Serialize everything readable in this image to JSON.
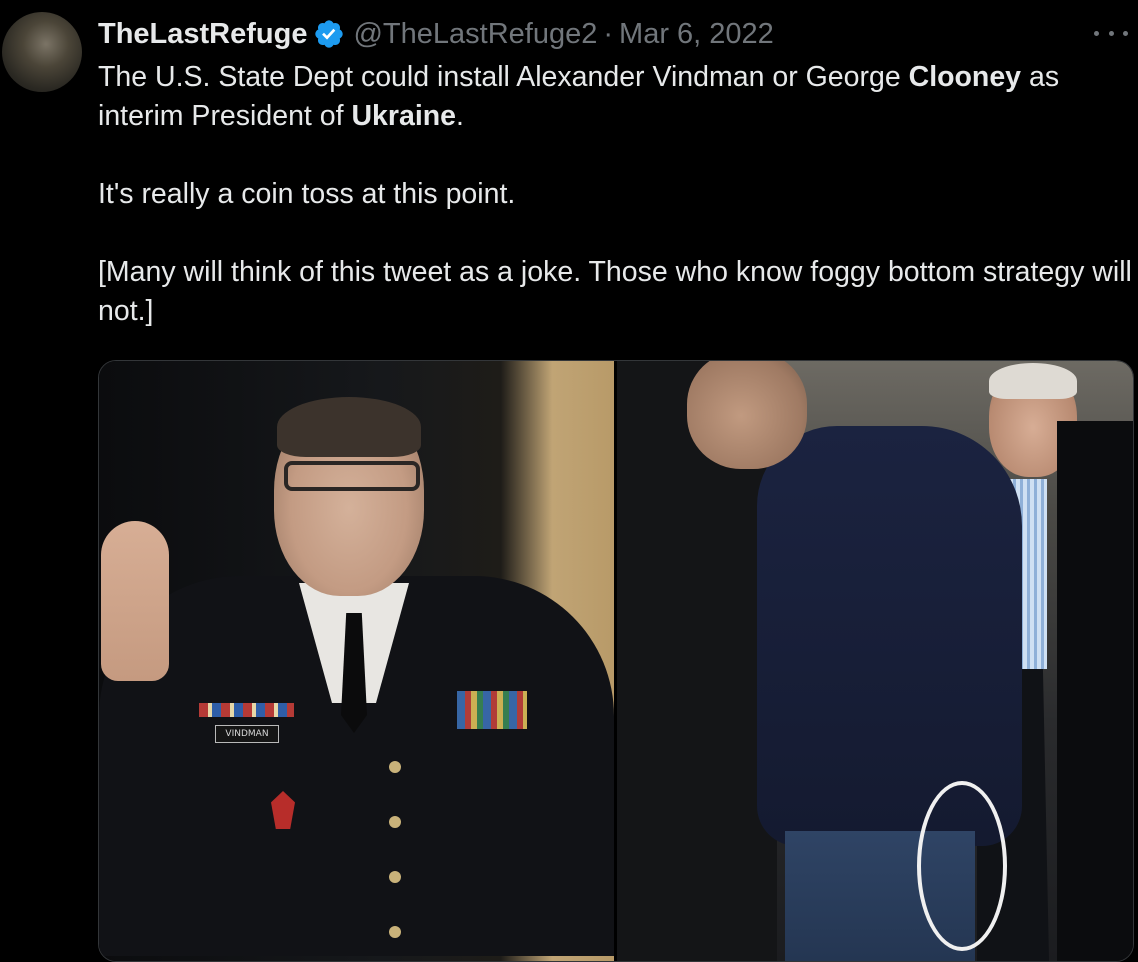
{
  "tweet": {
    "display_name": "TheLastRefuge",
    "handle": "@TheLastRefuge2",
    "separator": "·",
    "date": "Mar 6, 2022",
    "text": {
      "p1_part1": "The U.S. State Dept could install Alexander Vindman or George ",
      "p1_bold1": "Clooney",
      "p1_part2": " as interim President of ",
      "p1_bold2": "Ukraine",
      "p1_part3": ".",
      "p2": "It's really a coin toss at this point.",
      "p3": "[Many will think of this tweet as a joke. Those who know foggy bottom strategy will not.]"
    },
    "media": {
      "left_photo_nameplate": "VINDMAN"
    }
  },
  "colors": {
    "background": "#000000",
    "text": "#e7e9ea",
    "muted": "#71767b",
    "verified": "#1d9bf0",
    "border": "#333639"
  },
  "icons": {
    "verified": "verified-badge-icon",
    "more": "more-options-icon"
  }
}
